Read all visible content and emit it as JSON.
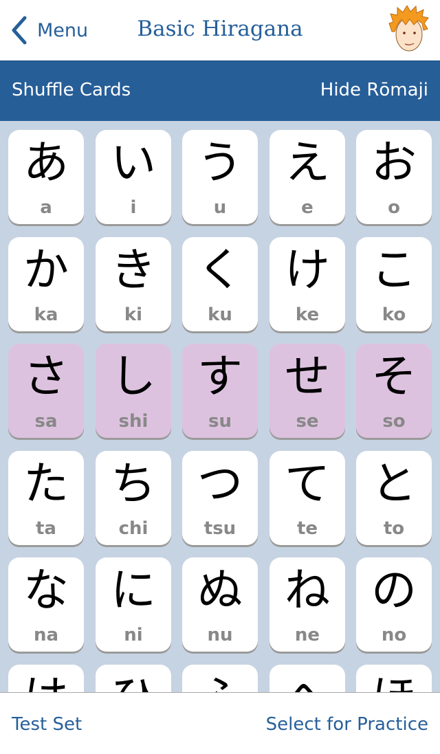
{
  "nav": {
    "back_label": "Menu",
    "title": "Basic Hiragana",
    "avatar_icon": "cartoon-boy-avatar"
  },
  "toolbar": {
    "shuffle_label": "Shuffle Cards",
    "hide_romaji_label": "Hide Rōmaji"
  },
  "colors": {
    "accent": "#265e98",
    "highlight": "#ddc2df",
    "grid_bg": "#c6d3e2"
  },
  "cards": [
    {
      "kana": "あ",
      "romaji": "a"
    },
    {
      "kana": "い",
      "romaji": "i"
    },
    {
      "kana": "う",
      "romaji": "u"
    },
    {
      "kana": "え",
      "romaji": "e"
    },
    {
      "kana": "お",
      "romaji": "o"
    },
    {
      "kana": "か",
      "romaji": "ka"
    },
    {
      "kana": "き",
      "romaji": "ki"
    },
    {
      "kana": "く",
      "romaji": "ku"
    },
    {
      "kana": "け",
      "romaji": "ke"
    },
    {
      "kana": "こ",
      "romaji": "ko"
    },
    {
      "kana": "さ",
      "romaji": "sa",
      "selected": true
    },
    {
      "kana": "し",
      "romaji": "shi",
      "selected": true
    },
    {
      "kana": "す",
      "romaji": "su",
      "selected": true
    },
    {
      "kana": "せ",
      "romaji": "se",
      "selected": true
    },
    {
      "kana": "そ",
      "romaji": "so",
      "selected": true
    },
    {
      "kana": "た",
      "romaji": "ta"
    },
    {
      "kana": "ち",
      "romaji": "chi"
    },
    {
      "kana": "つ",
      "romaji": "tsu"
    },
    {
      "kana": "て",
      "romaji": "te"
    },
    {
      "kana": "と",
      "romaji": "to"
    },
    {
      "kana": "な",
      "romaji": "na"
    },
    {
      "kana": "に",
      "romaji": "ni"
    },
    {
      "kana": "ぬ",
      "romaji": "nu"
    },
    {
      "kana": "ね",
      "romaji": "ne"
    },
    {
      "kana": "の",
      "romaji": "no"
    },
    {
      "kana": "は"
    },
    {
      "kana": "ひ"
    },
    {
      "kana": "ふ"
    },
    {
      "kana": "へ"
    },
    {
      "kana": "ほ"
    }
  ],
  "footer": {
    "test_label": "Test Set",
    "practice_label": "Select for Practice"
  }
}
